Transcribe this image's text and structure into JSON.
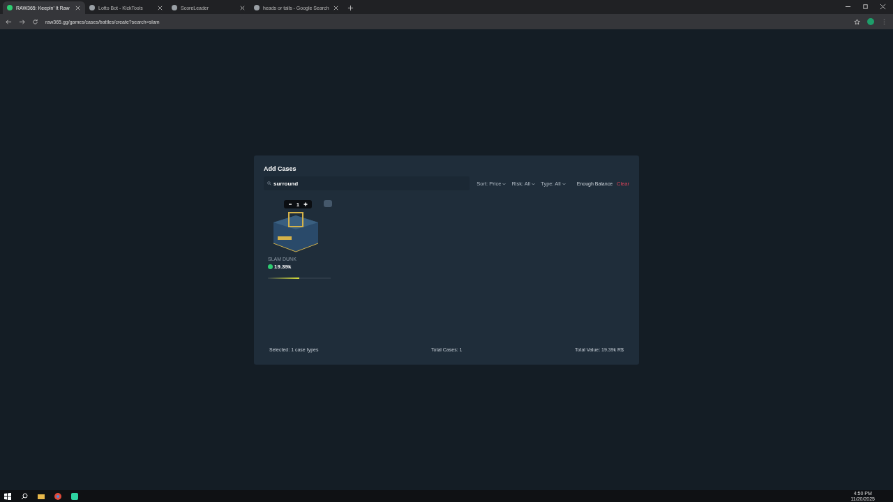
{
  "browser": {
    "tabs": [
      {
        "title": "RAW365: Keepin' It Raw",
        "selected": true
      },
      {
        "title": "Lotto Bot - KickTools",
        "selected": false
      },
      {
        "title": "ScoreLeader",
        "selected": false
      },
      {
        "title": "heads or tails - Google Search",
        "selected": false
      }
    ],
    "url": "raw365.gg/games/cases/battles/create?search=slam"
  },
  "modal": {
    "title": "Add Cases",
    "search": {
      "value": "surround"
    },
    "filters": [
      "Sort: Price",
      "Risk: All",
      "Type: All"
    ],
    "enough_balance": {
      "label": "Enough Balance",
      "on": false
    },
    "clear": "Clear",
    "cases": [
      {
        "quantity": "1",
        "name": "SLAM DUNK",
        "price": "19.39k",
        "level": 0.5
      }
    ],
    "footer": {
      "selected": "Selected: 1 case types",
      "total_cases": "Total Cases: 1",
      "total_value": "Total Value: 19.39k R$"
    }
  },
  "taskbar": {
    "time": "4:50 PM",
    "date": "11/20/2025"
  }
}
